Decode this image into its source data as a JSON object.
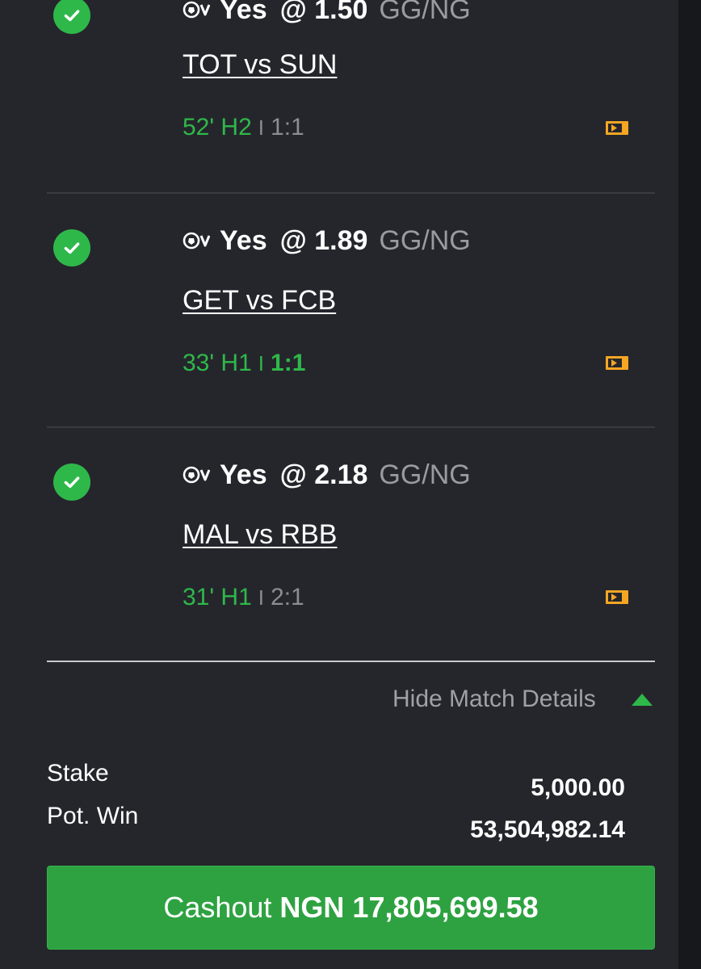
{
  "bets": [
    {
      "pick": "Yes",
      "odds_text": "@ 1.50",
      "market": "GG/NG",
      "match": "TOT vs SUN",
      "time": "52' H2",
      "separator": "I",
      "score": "1:1",
      "score_highlight": false
    },
    {
      "pick": "Yes",
      "odds_text": "@ 1.89",
      "market": "GG/NG",
      "match": "GET vs FCB",
      "time": "33' H1",
      "separator": "I",
      "score": "1:1",
      "score_highlight": true
    },
    {
      "pick": "Yes",
      "odds_text": "@ 2.18",
      "market": "GG/NG",
      "match": "MAL vs RBB",
      "time": "31' H1",
      "separator": "I",
      "score": "2:1",
      "score_highlight": false
    }
  ],
  "details_toggle": "Hide Match Details",
  "summary": {
    "stake_label": "Stake",
    "stake_value": "5,000.00",
    "pot_win_label": "Pot. Win",
    "pot_win_value": "53,504,982.14"
  },
  "cashout": {
    "label": "Cashout",
    "amount": "NGN 17,805,699.58"
  },
  "colors": {
    "background": "#25262c",
    "accent_green": "#2fb84a",
    "cashout_button": "#2ea241",
    "stats_icon": "#f5a623",
    "muted_text": "#9a9ba1"
  },
  "icons": {
    "settled": "check-circle-icon",
    "sport": "soccer-ball-icon",
    "stats": "live-stats-icon",
    "collapse": "triangle-up-icon"
  }
}
